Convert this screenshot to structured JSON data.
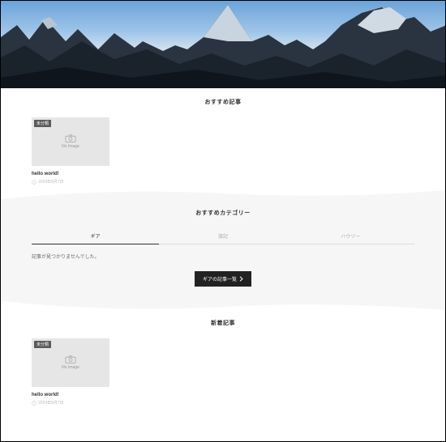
{
  "sections": {
    "recommended": {
      "title": "おすすめ記事"
    },
    "categories": {
      "title": "おすすめカテゴリー"
    },
    "latest": {
      "title": "新着記事"
    }
  },
  "card": {
    "badge": "未分類",
    "noimage": "No Image",
    "title": "hello world!",
    "date": "2024年8月7日"
  },
  "tabs": {
    "items": [
      "ギア",
      "旅記",
      "ハウツー"
    ],
    "active": "ギア"
  },
  "empty_message": "記事が見つかりませんでした。",
  "button": {
    "label": "ギアの記事一覧"
  }
}
